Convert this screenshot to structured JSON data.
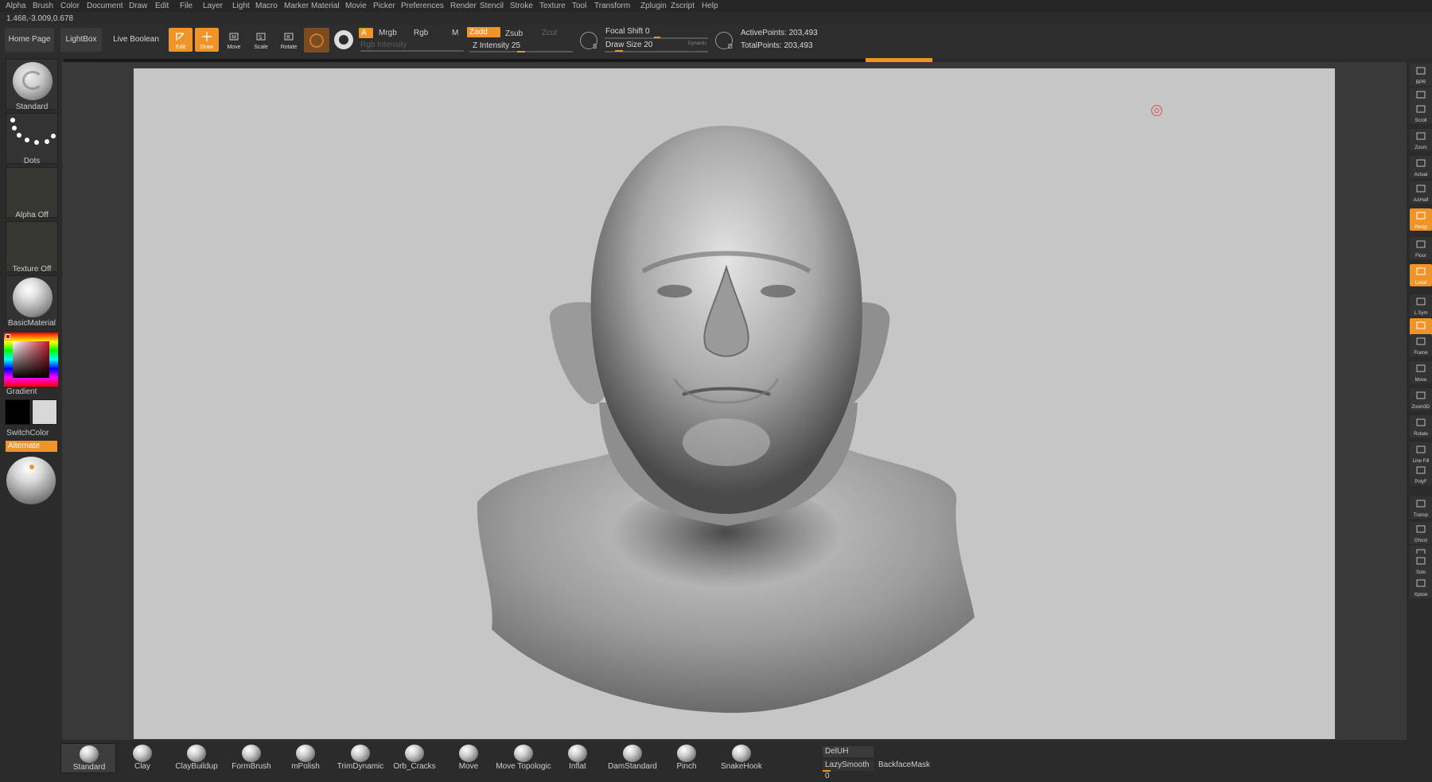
{
  "menu": [
    "Alpha",
    "Brush",
    "Color",
    "Document",
    "Draw",
    "Edit",
    "File",
    "Layer",
    "Light",
    "Macro",
    "Marker",
    "Material",
    "Movie",
    "Picker",
    "Preferences",
    "Render",
    "Stencil",
    "Stroke",
    "Texture",
    "Tool",
    "Transform",
    "Zplugin",
    "Zscript",
    "Help"
  ],
  "coords": "1.468,-3.009,0.678",
  "toolbar": {
    "home_page": "Home Page",
    "lightbox": "LightBox",
    "live_boolean": "Live Boolean",
    "edit": "Edit",
    "draw": "Draw",
    "move": "Move",
    "scale": "Scale",
    "rotate": "Rotate",
    "a": "A",
    "mrgb": "Mrgb",
    "rgb": "Rgb",
    "m": "M",
    "zadd": "Zadd",
    "zsub": "Zsub",
    "zcut": "Zcut",
    "rgb_intensity": "Rgb Intensity",
    "z_intensity": "Z Intensity 25",
    "focal_shift": "Focal Shift 0",
    "draw_size": "Draw Size 20",
    "dynamic": "Dynamic",
    "active_points": "ActivePoints: 203,493",
    "total_points": "TotalPoints: 203,493"
  },
  "left_shelf": {
    "brush": "Standard",
    "stroke": "Dots",
    "alpha": "Alpha Off",
    "texture": "Texture Off",
    "material": "BasicMaterial",
    "gradient": "Gradient",
    "switch_color": "SwitchColor",
    "alternate": "Alternate"
  },
  "right_shelf": [
    {
      "label": "BPR",
      "on": false
    },
    {
      "label": "SPix 3",
      "on": false
    },
    {
      "label": "Scroll",
      "on": false
    },
    {
      "label": "Zoom",
      "on": false
    },
    {
      "label": "Actual",
      "on": false
    },
    {
      "label": "AAHalf",
      "on": false
    },
    {
      "label": "Persp",
      "on": true
    },
    {
      "label": "Floor",
      "on": false
    },
    {
      "label": "Local",
      "on": true
    },
    {
      "label": "L.Sym",
      "on": false
    },
    {
      "label": "Xyz",
      "on": true
    },
    {
      "label": "Frame",
      "on": false
    },
    {
      "label": "Move",
      "on": false
    },
    {
      "label": "Zoom3D",
      "on": false
    },
    {
      "label": "Rotate",
      "on": false
    },
    {
      "label": "Line Fill",
      "on": false
    },
    {
      "label": "PolyF",
      "on": false
    },
    {
      "label": "Transp",
      "on": false
    },
    {
      "label": "Ghost",
      "on": false
    },
    {
      "label": "Dynamic",
      "on": false
    },
    {
      "label": "Solo",
      "on": false
    },
    {
      "label": "Xpose",
      "on": false
    }
  ],
  "brushes": [
    "Standard",
    "Clay",
    "ClayBuildup",
    "FormBrush",
    "mPolish",
    "TrimDynamic",
    "Orb_Cracks",
    "Move",
    "Move Topologic",
    "Inflat",
    "DamStandard",
    "Pinch",
    "SnakeHook"
  ],
  "bottom": {
    "deluh": "DelUH",
    "lazy_smooth": "LazySmooth 0",
    "backface_mask": "BackfaceMask"
  },
  "colors": {
    "accent": "#f0942a",
    "canvas": "#c6c6c6",
    "ui_bg": "#2b2b2b"
  }
}
